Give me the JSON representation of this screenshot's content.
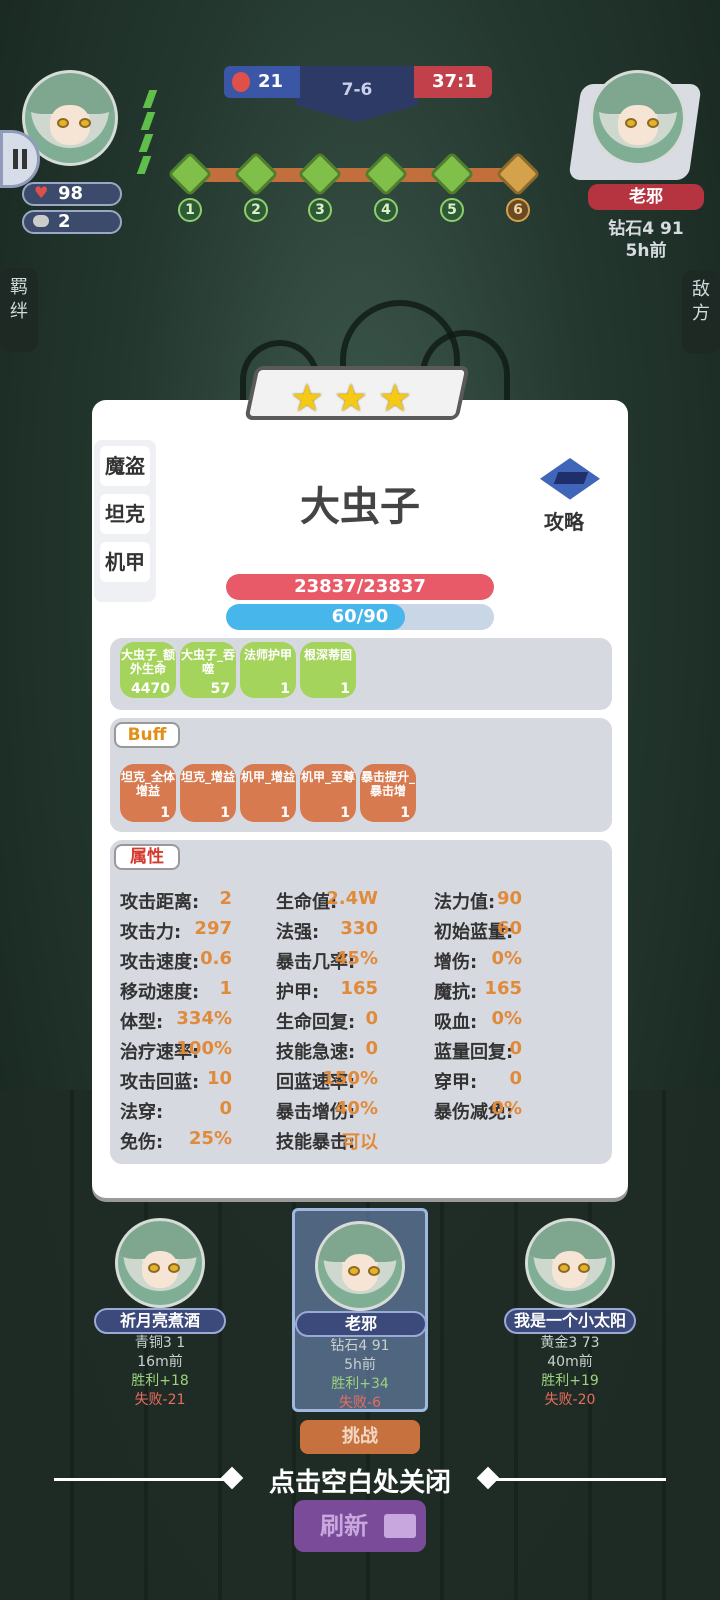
{
  "hud": {
    "player_hp": "98",
    "player_coins": "2",
    "left_score": "21",
    "round": "7-6",
    "right_score": "37:1",
    "stage_numbers": [
      "1",
      "2",
      "3",
      "4",
      "5",
      "6"
    ],
    "opponent": {
      "name": "老邪",
      "rank": "钻石4 91",
      "time": "5h前"
    },
    "left_tab": "羁绊",
    "right_tab": "敌方"
  },
  "unit": {
    "stars": 3,
    "name": "大虫子",
    "tags": [
      "魔盗",
      "坦克",
      "机甲"
    ],
    "guide_label": "攻略",
    "hp_text": "23837/23837",
    "hp_fraction": 1.0,
    "mana_text": "60/90",
    "mana_fraction": 0.667,
    "skills": [
      {
        "label": "大虫子_额外生命",
        "count": "4470"
      },
      {
        "label": "大虫子_吞噬",
        "count": "57"
      },
      {
        "label": "法师护甲",
        "count": "1"
      },
      {
        "label": "根深蒂固",
        "count": "1"
      }
    ],
    "buff_title": "Buff",
    "buffs": [
      {
        "label": "坦克_全体增益",
        "count": "1"
      },
      {
        "label": "坦克_增益",
        "count": "1"
      },
      {
        "label": "机甲_增益",
        "count": "1"
      },
      {
        "label": "机甲_至尊",
        "count": "1"
      },
      {
        "label": "暴击提升_暴击增",
        "count": "1"
      }
    ],
    "attr_title": "属性",
    "attributes": [
      {
        "k": "攻击距离:",
        "v": "2"
      },
      {
        "k": "生命值:",
        "v": "2.4W"
      },
      {
        "k": "法力值:",
        "v": "90"
      },
      {
        "k": "攻击力:",
        "v": "297"
      },
      {
        "k": "法强:",
        "v": "330"
      },
      {
        "k": "初始蓝量:",
        "v": "60"
      },
      {
        "k": "攻击速度:",
        "v": "0.6"
      },
      {
        "k": "暴击几率:",
        "v": "45%"
      },
      {
        "k": "增伤:",
        "v": "0%"
      },
      {
        "k": "移动速度:",
        "v": "1"
      },
      {
        "k": "护甲:",
        "v": "165"
      },
      {
        "k": "魔抗:",
        "v": "165"
      },
      {
        "k": "体型:",
        "v": "334%"
      },
      {
        "k": "生命回复:",
        "v": "0"
      },
      {
        "k": "吸血:",
        "v": "0%"
      },
      {
        "k": "治疗速率:",
        "v": "100%"
      },
      {
        "k": "技能急速:",
        "v": "0"
      },
      {
        "k": "蓝量回复:",
        "v": "0"
      },
      {
        "k": "攻击回蓝:",
        "v": "10"
      },
      {
        "k": "回蓝速率:",
        "v": "150%"
      },
      {
        "k": "穿甲:",
        "v": "0"
      },
      {
        "k": "法穿:",
        "v": "0"
      },
      {
        "k": "暴击增伤:",
        "v": "40%"
      },
      {
        "k": "暴伤减免:",
        "v": "0%"
      },
      {
        "k": "免伤:",
        "v": "25%"
      },
      {
        "k": "技能暴击:",
        "v": "可以"
      }
    ]
  },
  "opponents": [
    {
      "name": "祈月亮煮酒",
      "rank": "青铜3 1",
      "time": "16m前",
      "win": "胜利+18",
      "lose": "失败-21"
    },
    {
      "name": "老邪",
      "rank": "钻石4 91",
      "time": "5h前",
      "win": "胜利+34",
      "lose": "失败-6"
    },
    {
      "name": "我是一个小太阳",
      "rank": "黄金3 73",
      "time": "40m前",
      "win": "胜利+19",
      "lose": "失败-20"
    }
  ],
  "challenge_label": "挑战",
  "close_hint": "点击空白处关闭",
  "refresh_label": "刷新"
}
